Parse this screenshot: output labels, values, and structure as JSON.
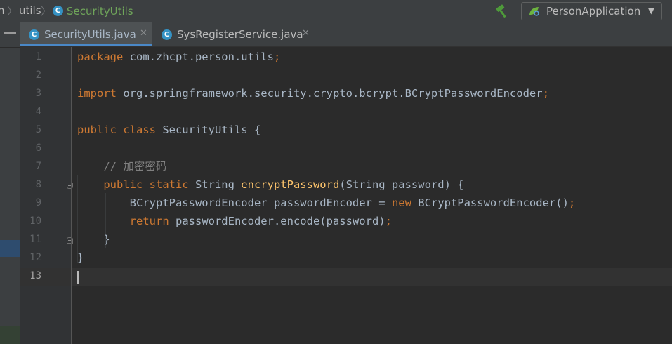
{
  "breadcrumb": {
    "project_fragment": "n",
    "folder": "utils",
    "class_name": "SecurityUtils",
    "class_icon_glyph": "C"
  },
  "toolbar": {
    "build_icon": "hammer-icon",
    "run_config": "PersonApplication",
    "run_config_icon": "spring-boot-icon",
    "dropdown_glyph": "▼"
  },
  "tabs": [
    {
      "label": "SecurityUtils.java",
      "active": true,
      "icon_glyph": "C",
      "close_glyph": "✕"
    },
    {
      "label": "SysRegisterService.java",
      "active": false,
      "icon_glyph": "C",
      "close_glyph": "✕"
    }
  ],
  "editor": {
    "current_line": 13,
    "lines": [
      {
        "n": "1",
        "t": [
          {
            "k": "kw",
            "v": "package"
          },
          {
            "k": "",
            "v": " com.zhcpt.person.utils"
          },
          {
            "k": "kw",
            "v": ";"
          }
        ]
      },
      {
        "n": "2",
        "t": []
      },
      {
        "n": "3",
        "t": [
          {
            "k": "kw",
            "v": "import"
          },
          {
            "k": "",
            "v": " org.springframework.security.crypto.bcrypt.BCryptPasswordEncoder"
          },
          {
            "k": "kw",
            "v": ";"
          }
        ]
      },
      {
        "n": "4",
        "t": []
      },
      {
        "n": "5",
        "t": [
          {
            "k": "kw",
            "v": "public class"
          },
          {
            "k": "",
            "v": " SecurityUtils {"
          }
        ]
      },
      {
        "n": "6",
        "t": []
      },
      {
        "n": "7",
        "t": [
          {
            "k": "cm",
            "v": "    // 加密密码"
          }
        ]
      },
      {
        "n": "8",
        "t": [
          {
            "k": "kw",
            "v": "    public static"
          },
          {
            "k": "",
            "v": " String "
          },
          {
            "k": "fn",
            "v": "encryptPassword"
          },
          {
            "k": "",
            "v": "(String password) {"
          }
        ]
      },
      {
        "n": "9",
        "t": [
          {
            "k": "",
            "v": "        BCryptPasswordEncoder passwordEncoder = "
          },
          {
            "k": "kw",
            "v": "new"
          },
          {
            "k": "",
            "v": " BCryptPasswordEncoder()"
          },
          {
            "k": "kw",
            "v": ";"
          }
        ]
      },
      {
        "n": "10",
        "t": [
          {
            "k": "kw",
            "v": "        return"
          },
          {
            "k": "",
            "v": " passwordEncoder.encode(password)"
          },
          {
            "k": "kw",
            "v": ";"
          }
        ]
      },
      {
        "n": "11",
        "t": [
          {
            "k": "",
            "v": "    }"
          }
        ]
      },
      {
        "n": "12",
        "t": [
          {
            "k": "",
            "v": "}"
          }
        ]
      },
      {
        "n": "13",
        "t": []
      }
    ]
  },
  "colors": {
    "keyword": "#cc7832",
    "function": "#ffc66d",
    "comment": "#808080",
    "text": "#a9b7c6",
    "accent": "#4a88c7"
  }
}
